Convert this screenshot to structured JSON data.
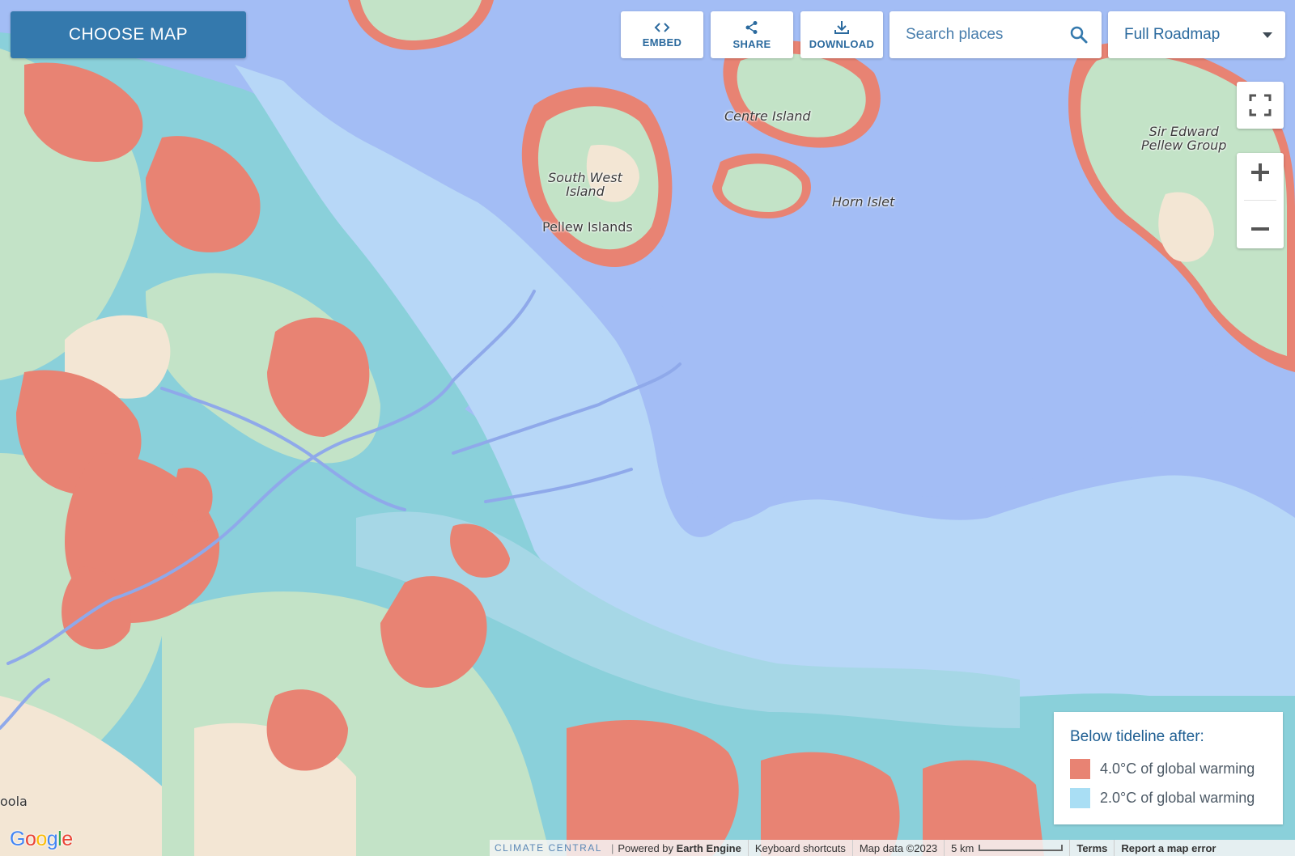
{
  "header": {
    "choose_map_label": "CHOOSE MAP",
    "embed_label": "EMBED",
    "share_label": "SHARE",
    "download_label": "DOWNLOAD",
    "search_placeholder": "Search places",
    "basemap_value": "Full Roadmap"
  },
  "map_labels": {
    "centre_island": "Centre Island",
    "sir_edward_line1": "Sir Edward",
    "sir_edward_line2": "Pellew Group",
    "south_west_line1": "South West",
    "south_west_line2": "Island",
    "horn_islet": "Horn Islet",
    "pellew_islands": "Pellew Islands",
    "edge_partial": "oola"
  },
  "legend": {
    "title": "Below tideline after:",
    "items": [
      {
        "label": "4.0°C of global warming",
        "color": "#e88373"
      },
      {
        "label": "2.0°C of global warming",
        "color": "#a9def4"
      }
    ]
  },
  "footer": {
    "brand": "CLIMATE CENTRAL",
    "powered_prefix": "Powered by",
    "powered_bold": "Earth Engine",
    "keyboard_shortcuts": "Keyboard shortcuts",
    "map_data": "Map data ©2023",
    "scale_label": "5 km",
    "terms": "Terms",
    "report_error": "Report a map error"
  },
  "google_logo": "Google",
  "colors": {
    "water": "#a3bdf5",
    "land": "#c3e3c7",
    "sand": "#f3e6d4",
    "risk_4c": "#e88373",
    "risk_2c": "#8ad0da",
    "tidal_flat": "#b7d7f7",
    "accent": "#3479ad"
  }
}
